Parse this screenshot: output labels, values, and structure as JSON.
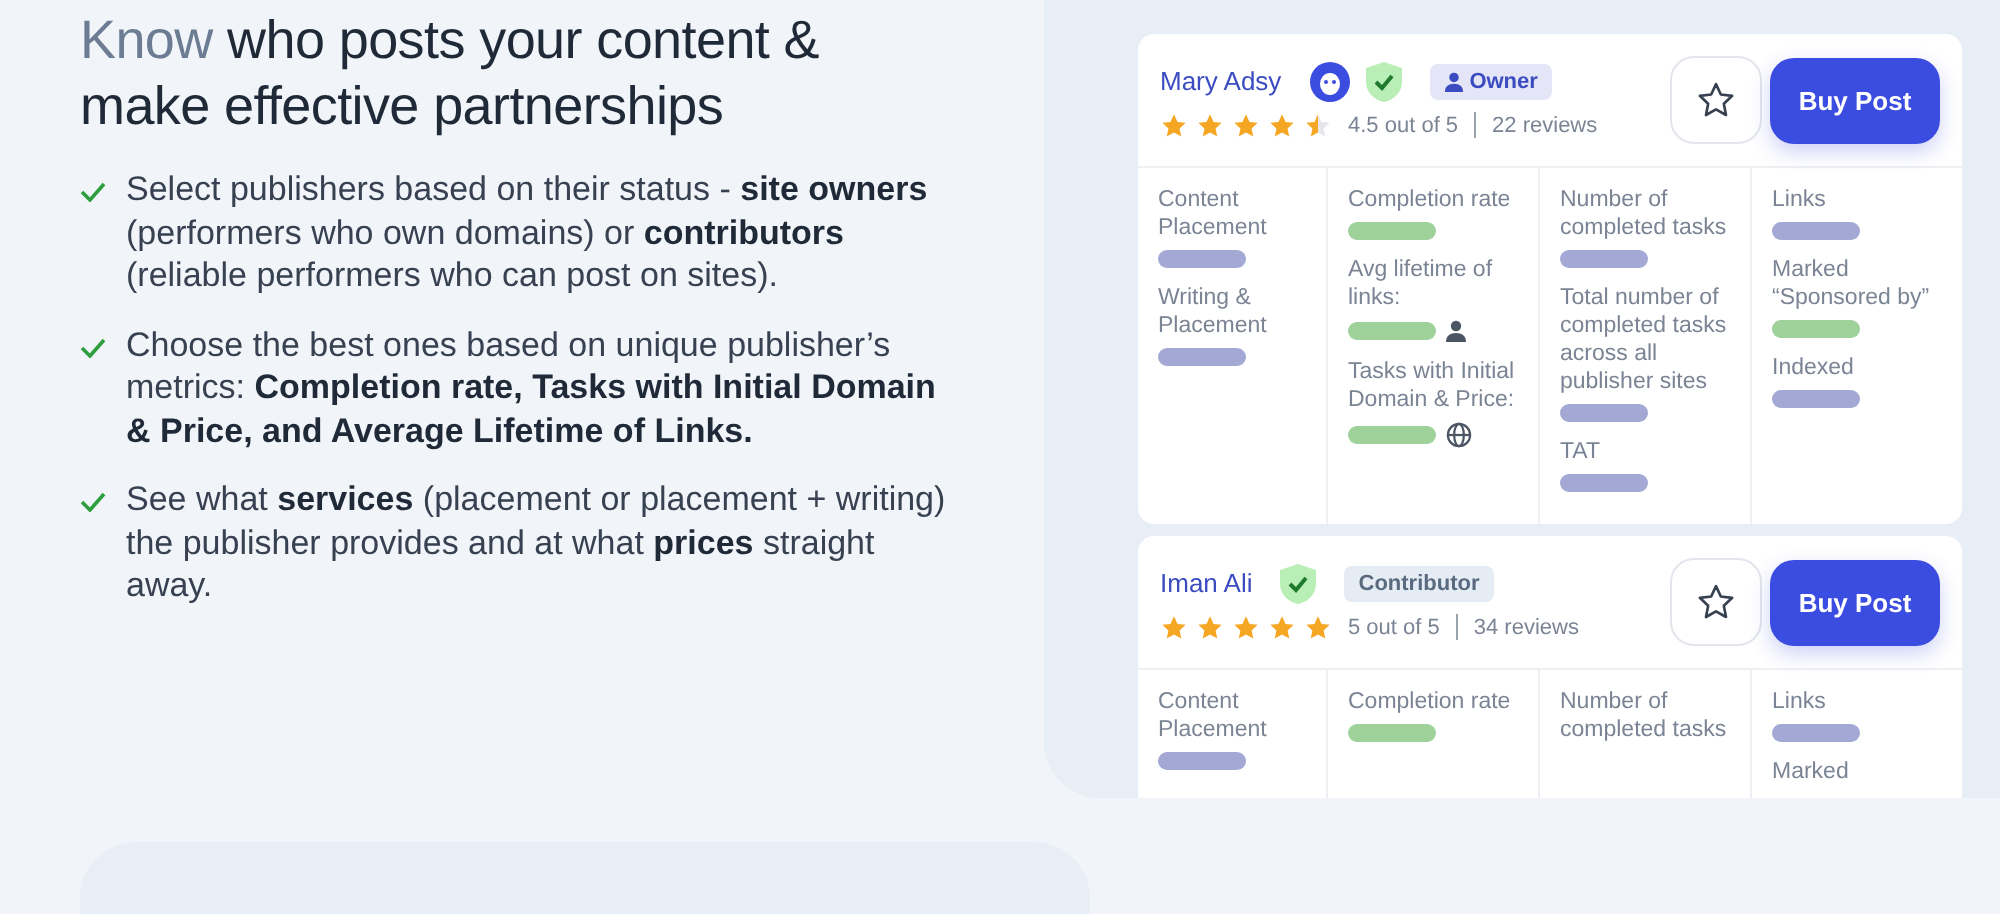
{
  "heading": {
    "accent": "Know",
    "rest": "who posts your content & make effective partnerships"
  },
  "bullets": [
    "Select publishers based on their status - **site owners** (performers who own domains) or **contributors** (reliable performers who can post on sites).",
    "Choose the best ones based on unique publisher’s metrics: **Completion rate, Tasks with Initial Domain & Price, and Average Lifetime of Links.**",
    "See what **services** (placement or placement + writing) the publisher provides and at what **prices** straight away."
  ],
  "cards": [
    {
      "name": "Mary Adsy",
      "badges": [
        {
          "kind": "logo"
        },
        {
          "kind": "verified"
        }
      ],
      "role": {
        "kind": "owner",
        "label": "Owner"
      },
      "stars": 4.5,
      "rating": "4.5 out of 5",
      "reviews": "22 reviews",
      "button": "Buy Post",
      "columns": [
        [
          {
            "kind": "label",
            "text": "Content Placement"
          },
          {
            "kind": "bar",
            "color": "#a3a8d4"
          },
          {
            "kind": "label",
            "text": "Writing & Placement"
          },
          {
            "kind": "bar",
            "color": "#a3a8d4"
          }
        ],
        [
          {
            "kind": "label",
            "text": "Completion rate"
          },
          {
            "kind": "bar",
            "color": "#9fd19a"
          },
          {
            "kind": "label",
            "text": "Avg lifetime of links:"
          },
          {
            "kind": "userbar",
            "color": "#9fd19a"
          },
          {
            "kind": "label",
            "text": "Tasks with Initial Domain & Price:"
          },
          {
            "kind": "globebar",
            "color": "#9fd19a"
          }
        ],
        [
          {
            "kind": "label",
            "text": "Number of completed tasks"
          },
          {
            "kind": "bar",
            "color": "#a3a8d4"
          },
          {
            "kind": "label",
            "text": "Total number of completed tasks across all publisher sites"
          },
          {
            "kind": "bar",
            "color": "#a3a8d4"
          },
          {
            "kind": "label",
            "text": "TAT"
          },
          {
            "kind": "bar",
            "color": "#a3a8d4"
          }
        ],
        [
          {
            "kind": "label",
            "text": "Links"
          },
          {
            "kind": "bar",
            "color": "#a3a8d4"
          },
          {
            "kind": "label",
            "text": "Marked “Sponsored by”"
          },
          {
            "kind": "bar",
            "color": "#9fd19a"
          },
          {
            "kind": "label",
            "text": "Indexed"
          },
          {
            "kind": "bar",
            "color": "#a3a8d4"
          }
        ]
      ]
    },
    {
      "name": "Iman Ali",
      "badges": [
        {
          "kind": "verified"
        }
      ],
      "role": {
        "kind": "contributor",
        "label": "Contributor"
      },
      "stars": 5,
      "rating": "5 out of 5",
      "reviews": "34 reviews",
      "button": "Buy Post",
      "columns": [
        [
          {
            "kind": "label",
            "text": "Content Placement"
          },
          {
            "kind": "bar",
            "color": "#a3a8d4"
          }
        ],
        [
          {
            "kind": "label",
            "text": "Completion rate"
          },
          {
            "kind": "bar",
            "color": "#9fd19a"
          }
        ],
        [
          {
            "kind": "label",
            "text": "Number of completed tasks"
          }
        ],
        [
          {
            "kind": "label",
            "text": "Links"
          },
          {
            "kind": "bar",
            "color": "#a3a8d4"
          },
          {
            "kind": "label",
            "text": "Marked"
          }
        ]
      ]
    }
  ]
}
